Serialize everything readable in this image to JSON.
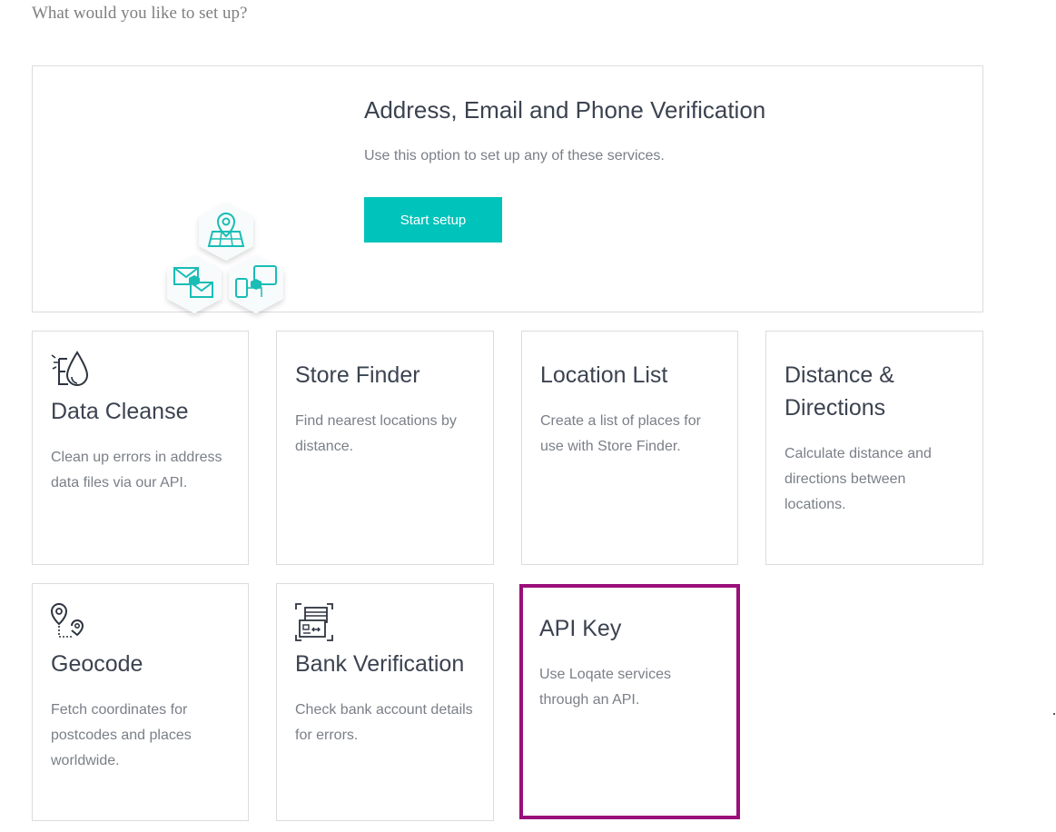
{
  "page": {
    "question": "What would you like to set up?"
  },
  "hero": {
    "title": "Address, Email and Phone Verification",
    "description": "Use this option to set up any of these services.",
    "button_label": "Start setup",
    "accent_color": "#00c3bb"
  },
  "tiles": [
    {
      "title": "Data Cleanse",
      "description": "Clean up errors in address data files via our API.",
      "icon": "data-cleanse-icon"
    },
    {
      "title": "Store Finder",
      "description": "Find nearest locations by distance."
    },
    {
      "title": "Location List",
      "description": "Create a list of places for use with Store Finder."
    },
    {
      "title": "Distance & Directions",
      "description": "Calculate distance and directions between locations."
    },
    {
      "title": "Geocode",
      "description": "Fetch coordinates for postcodes and places worldwide.",
      "icon": "geocode-icon"
    },
    {
      "title": "Bank Verification",
      "description": "Check bank account details for errors.",
      "icon": "bank-card-icon"
    },
    {
      "title": "API Key",
      "description": "Use Loqate services through an API.",
      "highlighted": true,
      "highlight_color": "#9b0f7a"
    }
  ]
}
